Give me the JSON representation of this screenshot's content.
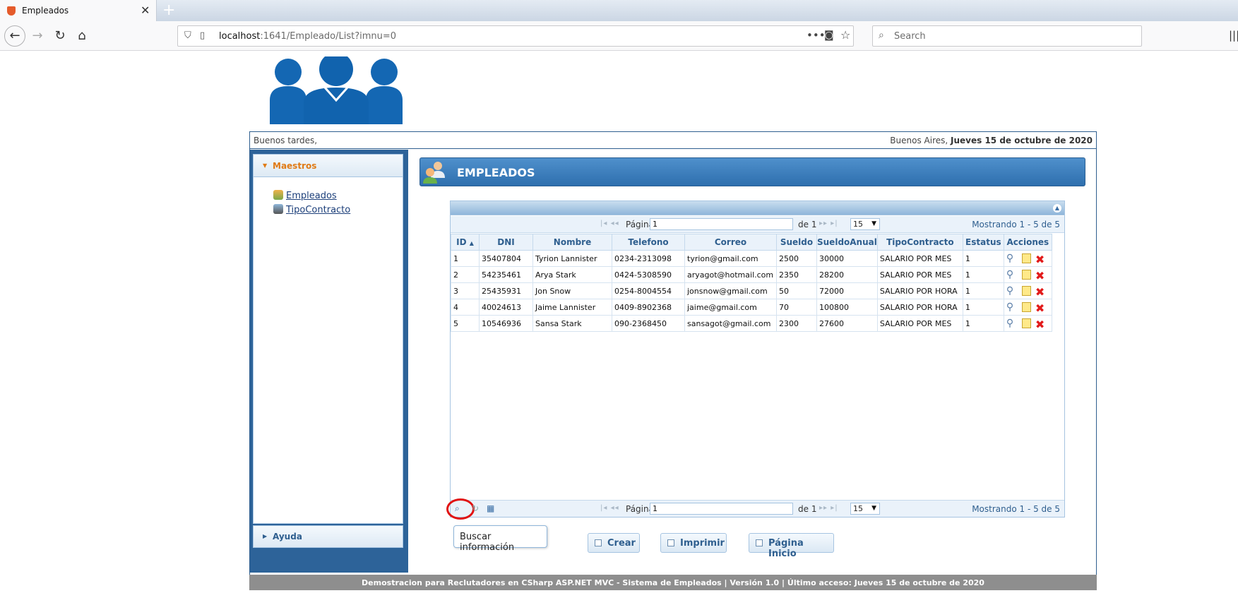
{
  "browser": {
    "tab_title": "Empleados",
    "url_host": "localhost",
    "url_rest": ":1641/Empleado/List?imnu=0",
    "search_placeholder": "Search"
  },
  "topbar": {
    "greeting": "Buenos tardes,",
    "city": "Buenos Aires, ",
    "date": "Jueves 15 de octubre de 2020"
  },
  "sidebar": {
    "section": "Maestros",
    "items": [
      {
        "label": "Empleados"
      },
      {
        "label": "TipoContracto"
      }
    ],
    "help": "Ayuda"
  },
  "main": {
    "title": "EMPLEADOS"
  },
  "pager": {
    "page_label": "Página",
    "page_value": "1",
    "of_label": "de 1",
    "rows_value": "15",
    "info": "Mostrando 1 - 5 de 5"
  },
  "table": {
    "columns": [
      "ID",
      "DNI",
      "Nombre",
      "Telefono",
      "Correo",
      "Sueldo",
      "SueldoAnual",
      "TipoContracto",
      "Estatus",
      "Acciones"
    ],
    "rows": [
      [
        "1",
        "35407804",
        "Tyrion Lannister",
        "0234-2313098",
        "tyrion@gmail.com",
        "2500",
        "30000",
        "SALARIO POR MES",
        "1"
      ],
      [
        "2",
        "54235461",
        "Arya Stark",
        "0424-5308590",
        "aryagot@hotmail.com",
        "2350",
        "28200",
        "SALARIO POR MES",
        "1"
      ],
      [
        "3",
        "25435931",
        "Jon Snow",
        "0254-8004554",
        "jonsnow@gmail.com",
        "50",
        "72000",
        "SALARIO POR HORA",
        "1"
      ],
      [
        "4",
        "40024613",
        "Jaime Lannister",
        "0409-8902368",
        "jaime@gmail.com",
        "70",
        "100800",
        "SALARIO POR HORA",
        "1"
      ],
      [
        "5",
        "10546936",
        "Sansa Stark",
        "090-2368450",
        "sansagot@gmail.com",
        "2300",
        "27600",
        "SALARIO POR MES",
        "1"
      ]
    ]
  },
  "tooltip": "Buscar información",
  "buttons": {
    "create": "Crear",
    "print": "Imprimir",
    "home": "Página Inicio"
  },
  "footer": "Demostracion para Reclutadores en CSharp ASP.NET MVC - Sistema de Empleados | Versión 1.0 | Último acceso: Jueves 15 de octubre de 2020",
  "colors": {
    "header_blue": "#2e6fae",
    "section_orange": "#e07b16",
    "delete_red": "#e21b1b"
  }
}
